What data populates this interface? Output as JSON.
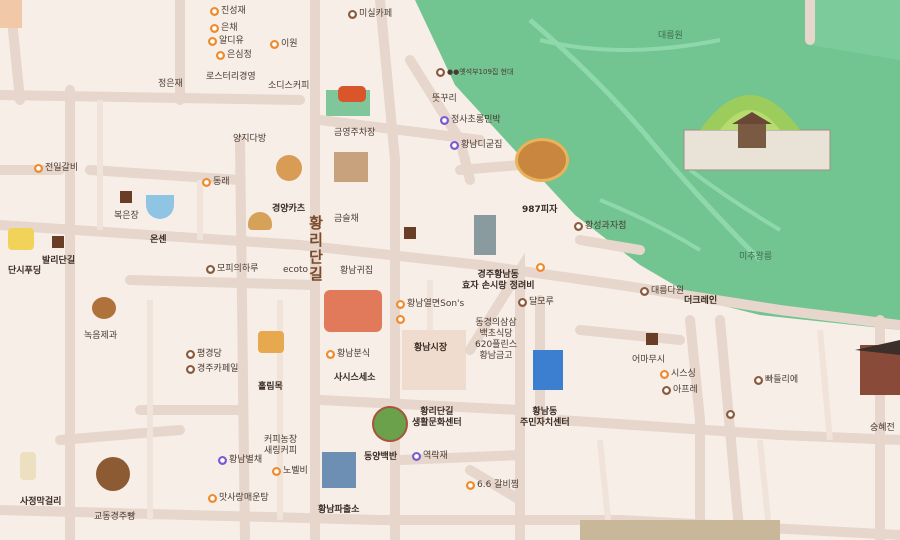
{
  "street_name": [
    "황",
    "리",
    "단",
    "길"
  ],
  "areas": {
    "park_top": "대릉원",
    "park_bottom": "미추왕릉"
  },
  "labels": {
    "jeongeonjae": "정은재",
    "sodis": "소디스커피",
    "yangjidabang": "양지다방",
    "geumyoung": "금영주차장",
    "jeonilgigi": "전일갈비",
    "bokeunjang": "복은장",
    "onseon": "온센",
    "danse_pudding": "단시푸딩",
    "balleodangil": "발리단길",
    "gyeongyang": "경양카츠",
    "geumseulchae": "금슬채",
    "mopi": "모피의하루",
    "ecoto": "ecoto",
    "hwangnamguipjip": "황남귀집",
    "nokeum": "녹음제과",
    "pyeonggyeongdang": "평경당",
    "gyeongjucafe": "경주카페일",
    "hollim": "홀림목",
    "hwangnamboonsik": "황남분식",
    "sasiseuse": "사시스세소",
    "hwangnammarket": "황남시장",
    "coffee_saeyeon": "커피농장\n새링커피",
    "hwangnambyeol": "황남별채",
    "nobyeol": "노벨비",
    "matsa": "맛사랑매운탕",
    "sajeonggil": "사정막걸리",
    "gyodong": "교동경주빵",
    "hwangnampolice": "황남파출소",
    "dongyang": "동양백반",
    "yeokjae": "역락재",
    "hwangni_center": "황리단길\n생활문화센터",
    "galbi66": "6.6 갈비찜",
    "hwangnam_office": "황남동\n주민자치센터",
    "dalmole": "달모루",
    "gyeongjuhwangnam": "경주황남동\n효자 손시랑 정려비",
    "hwangnamyulmyeon": "황남열면Son's",
    "samsam": "동경의삼삼\n백초식당\n620플린스\n황남금고",
    "pizza987": "987피자",
    "hwangseongjaju": "황성과자점",
    "daenung": "대릉다원",
    "cheokraeon": "더크레인",
    "eomamusi": "어마무시",
    "sisseung": "시스싱",
    "apeleo": "아프레",
    "ppadeullie": "빠들리에",
    "seungheoljeon": "숭혜전",
    "hwangnamdi": "황남디굳집",
    "jeongsa": "정사초롱민박",
    "tteutguri": "뜻꾸리",
    "jinsungjae": "진성재",
    "misilcafe": "미실카페",
    "aldiyu": "알디유",
    "eunchae": "은채",
    "eunsim": "은심정",
    "iyeon": "이원",
    "rosterigyeong": "로스터리경영",
    "goldmark": "●●옛석부109집 현대"
  }
}
